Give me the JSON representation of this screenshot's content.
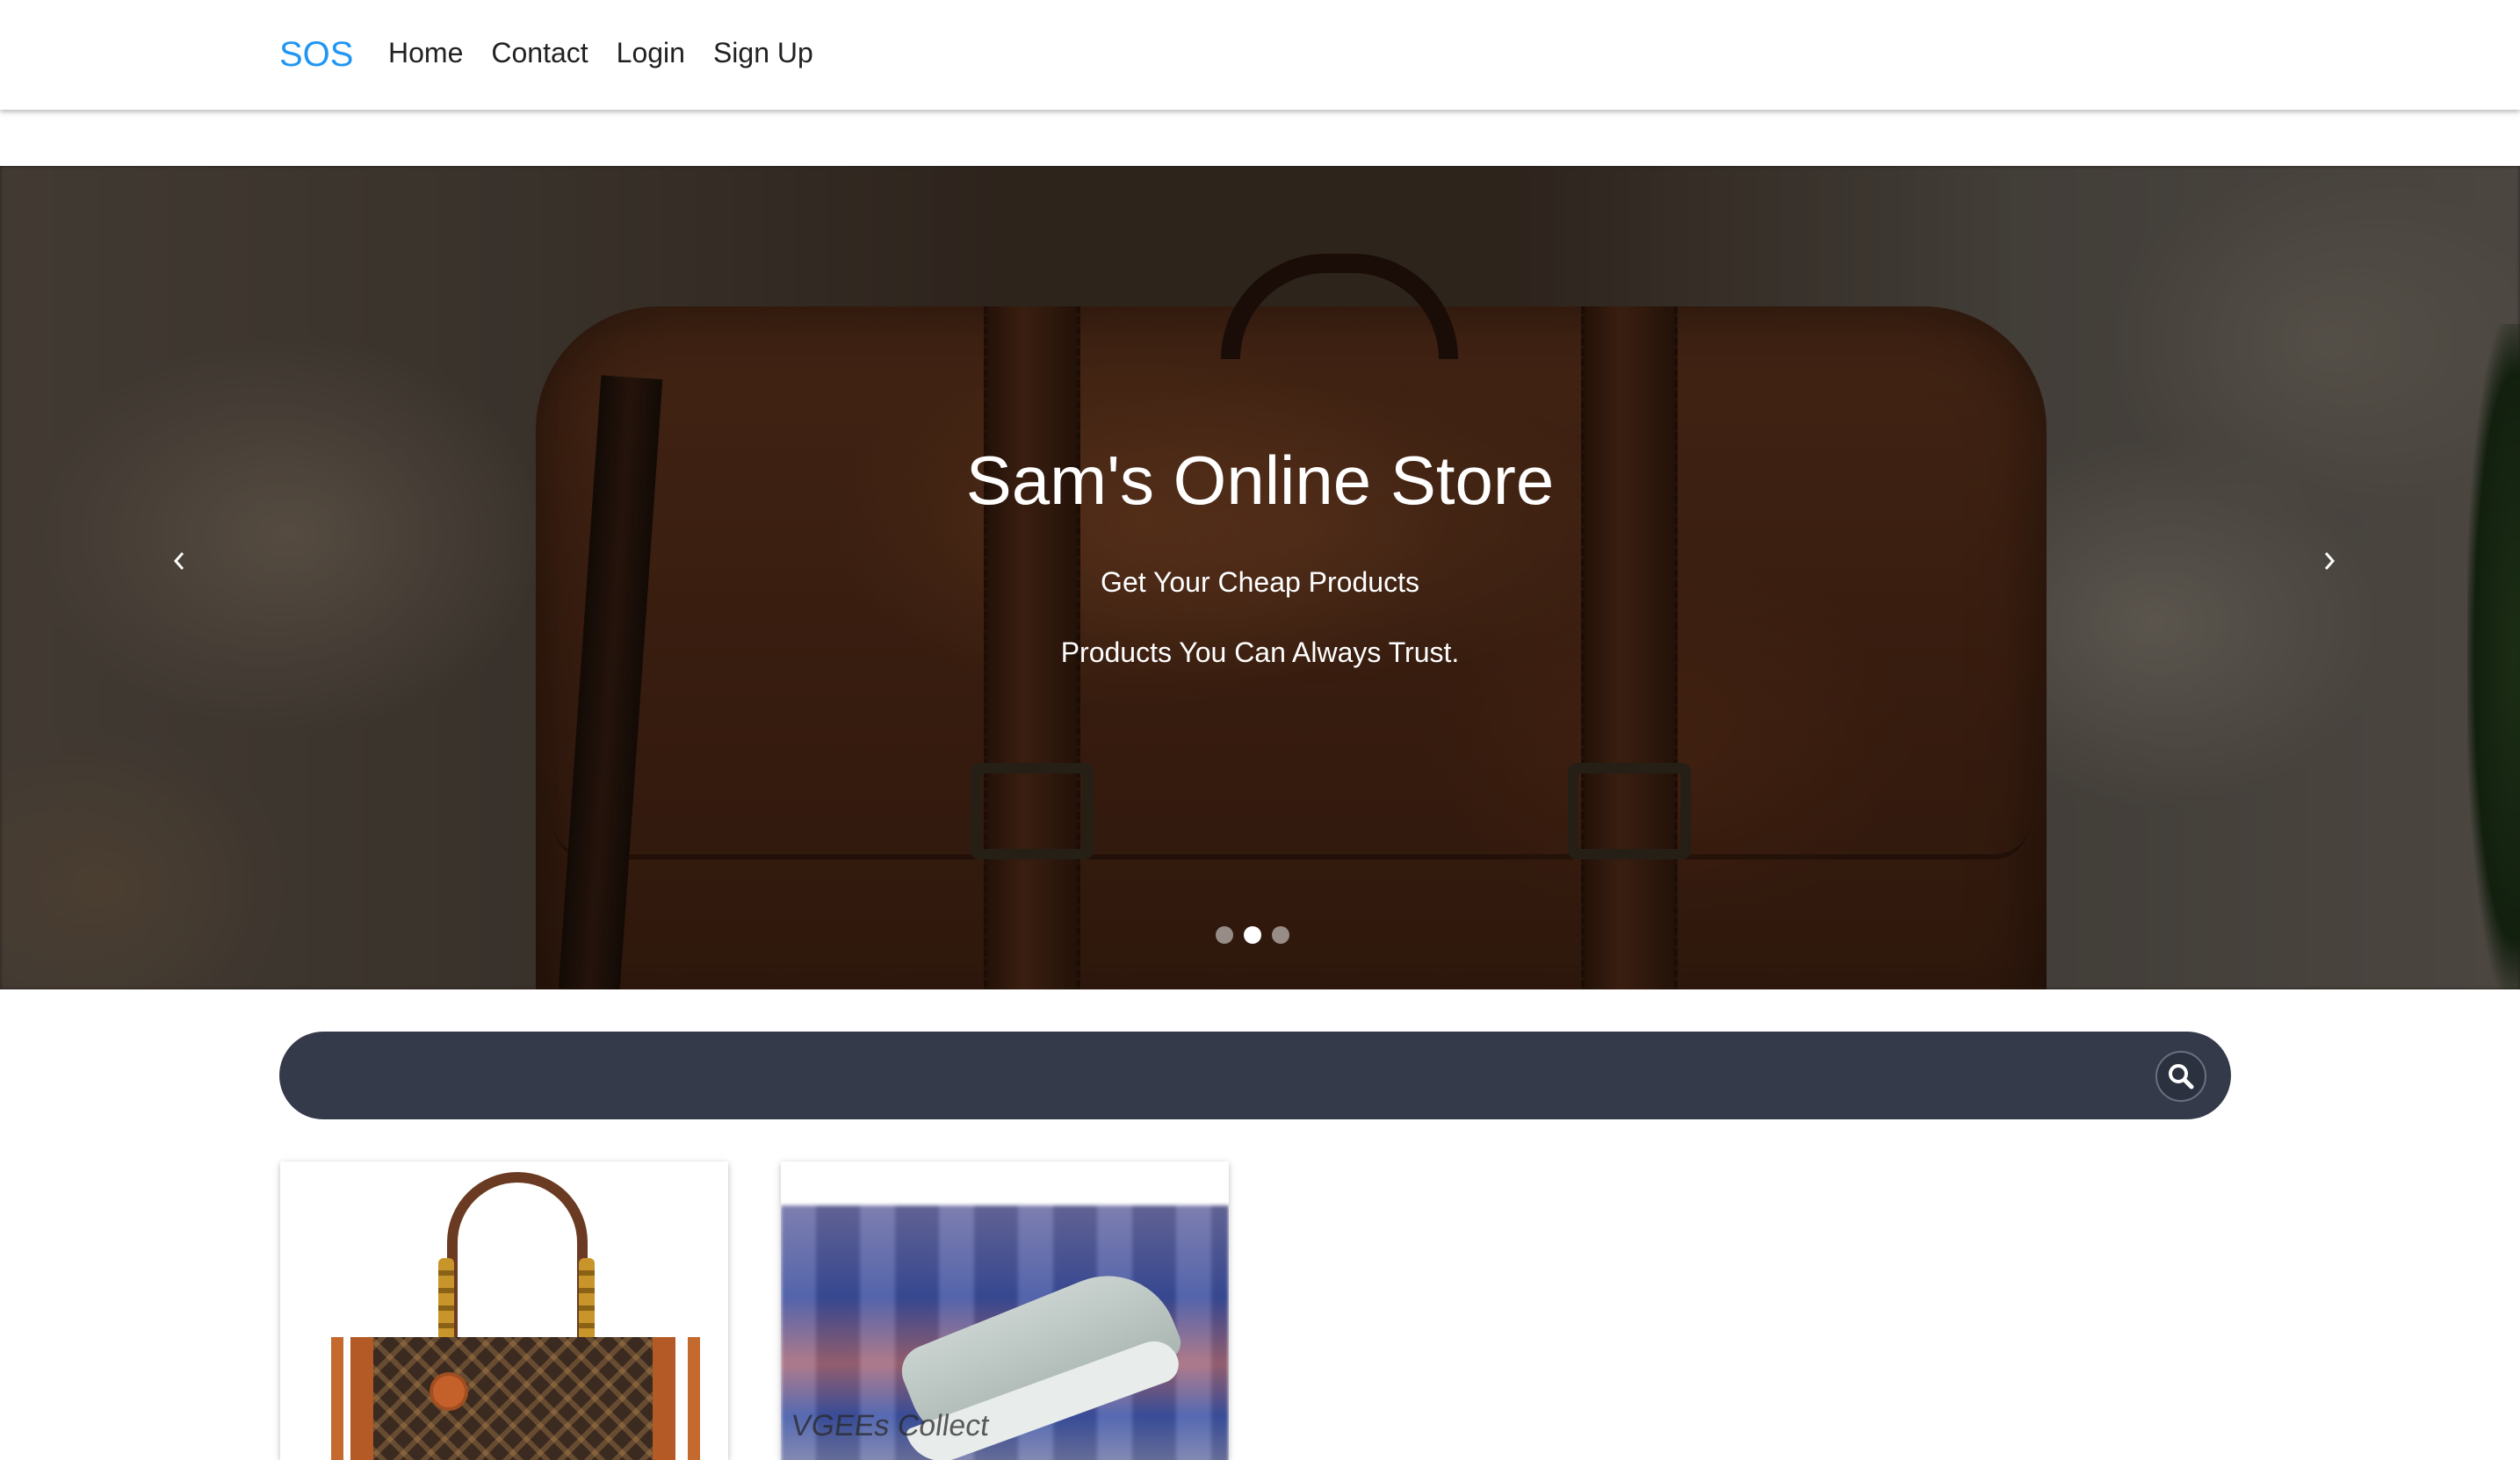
{
  "navbar": {
    "brand": "SOS",
    "links": [
      "Home",
      "Contact",
      "Login",
      "Sign Up"
    ]
  },
  "hero": {
    "title": "Sam's Online Store",
    "line1": "Get Your Cheap Products",
    "line2": "Products You Can Always Trust.",
    "slides": 3,
    "active_slide": 2
  },
  "search": {
    "value": "",
    "placeholder": ""
  },
  "products": [
    {
      "name": "handbag",
      "image": "handbag-image"
    },
    {
      "name": "sneaker",
      "image": "sneaker-image",
      "watermark": "VGEEs Collect"
    }
  ],
  "colors": {
    "brand": "#2196f3",
    "search_bar": "#343a4a"
  },
  "icons": {
    "prev": "chevron-left-icon",
    "next": "chevron-right-icon",
    "search": "search-icon"
  }
}
